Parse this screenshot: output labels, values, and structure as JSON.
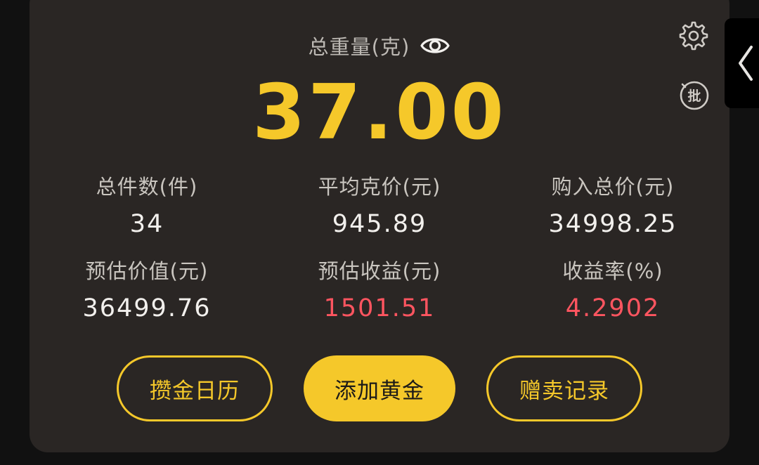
{
  "header": {
    "label": "总重量(克)",
    "visibility_icon": "eye-icon"
  },
  "total_weight": "37.00",
  "side_icons": {
    "settings": "gear-icon",
    "batch": "batch-icon",
    "batch_glyph": "批",
    "collapse": "chevron-left-icon"
  },
  "stats": [
    {
      "label": "总件数(件)",
      "value": "34",
      "color": "#f2f0ed"
    },
    {
      "label": "平均克价(元)",
      "value": "945.89",
      "color": "#f2f0ed"
    },
    {
      "label": "购入总价(元)",
      "value": "34998.25",
      "color": "#f2f0ed"
    },
    {
      "label": "预估价值(元)",
      "value": "36499.76",
      "color": "#f2f0ed"
    },
    {
      "label": "预估收益(元)",
      "value": "1501.51",
      "color": "#ff5560"
    },
    {
      "label": "收益率(%)",
      "value": "4.2902",
      "color": "#ff5560"
    }
  ],
  "actions": {
    "calendar": "攒金日历",
    "add_gold": "添加黄金",
    "records": "赠卖记录"
  },
  "colors": {
    "accent": "#f5c82a",
    "card_bg": "#2a2624",
    "positive": "#ff5560"
  }
}
